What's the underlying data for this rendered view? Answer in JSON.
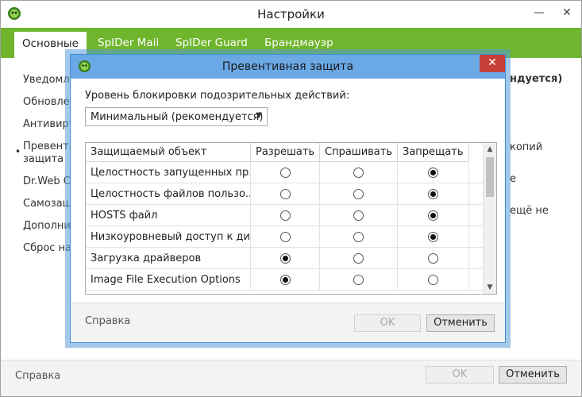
{
  "window": {
    "title": "Настройки",
    "minimize": "—",
    "close": "✕"
  },
  "tabs": [
    {
      "label": "Основные"
    },
    {
      "label": "SpIDer Mail"
    },
    {
      "label": "SpIDer Guard"
    },
    {
      "label": "Брандмауэр"
    }
  ],
  "sidebar": {
    "items": [
      {
        "label": "Уведомле"
      },
      {
        "label": "Обновлен"
      },
      {
        "label": "Антивиру"
      },
      {
        "label": "Превенти"
      },
      {
        "label": "защита"
      },
      {
        "label": "Dr.Web Cl"
      },
      {
        "label": "Самозащ"
      },
      {
        "label": "Дополнит"
      },
      {
        "label": "Сброс нас"
      }
    ],
    "bullet": "•"
  },
  "right_fragments": {
    "t1": "ндуется)",
    "t2": "копий",
    "t3": "е",
    "t4": "ещё не"
  },
  "footer": {
    "help": "Справка",
    "ok": "OK",
    "cancel": "Отменить"
  },
  "dialog": {
    "title": "Превентивная защита",
    "close": "✕",
    "level_label": "Уровень блокировки подозрительных действий:",
    "level_value": "Минимальный (рекомендуется)",
    "select_arrow": "▼",
    "table": {
      "headers": [
        "Защищаемый объект",
        "Разрешать",
        "Спрашивать",
        "Запрещать"
      ],
      "rows": [
        {
          "name": "Целостность запущенных пр...",
          "choice": 3
        },
        {
          "name": "Целостность файлов пользо...",
          "choice": 3
        },
        {
          "name": "HOSTS файл",
          "choice": 3
        },
        {
          "name": "Низкоуровневый доступ к ди...",
          "choice": 3
        },
        {
          "name": "Загрузка драйверов",
          "choice": 1
        },
        {
          "name": "Image File Execution Options",
          "choice": 1
        }
      ]
    },
    "scroll_up": "▲",
    "scroll_down": "▼",
    "help": "Справка",
    "ok": "OK",
    "cancel": "Отменить"
  },
  "colors": {
    "accent_green": "#6fb52d",
    "dialog_title_blue": "#6aa8e6",
    "close_red": "#c7413a"
  }
}
